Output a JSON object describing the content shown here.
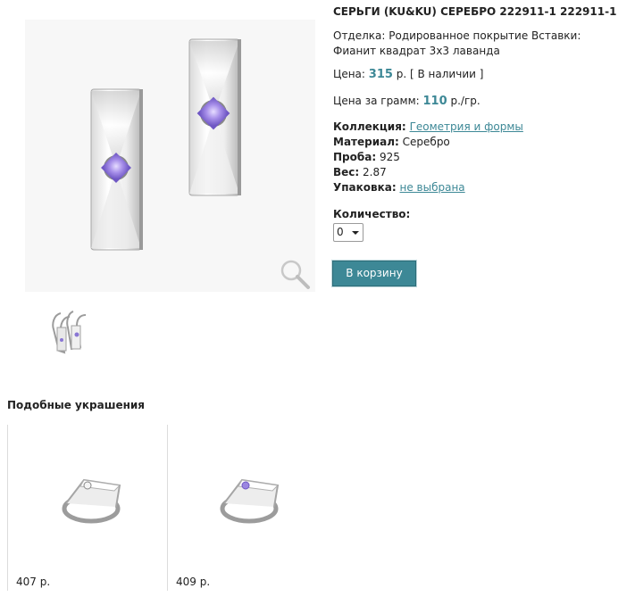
{
  "product": {
    "title": "СЕРЬГИ (KU&KU) СЕРЕБРО 222911-1 222911-1",
    "finish": "Отделка: Родированное покрытие Вставки: Фианит квадрат 3х3 лаванда",
    "price_label": "Цена:",
    "price_value": "315",
    "price_unit": "р.",
    "availability": "[ В наличии ]",
    "price_per_gram_label": "Цена за грамм:",
    "price_per_gram_value": "110",
    "price_per_gram_unit": "р./гр."
  },
  "specs": {
    "collection_label": "Коллекция:",
    "collection_value": "Геометрия и формы",
    "material_label": "Материал:",
    "material_value": "Серебро",
    "probe_label": "Проба:",
    "probe_value": "925",
    "weight_label": "Вес:",
    "weight_value": "2.87",
    "packaging_label": "Упаковка:",
    "packaging_value": "не выбрана"
  },
  "quantity": {
    "label": "Количество:",
    "value": "0"
  },
  "cart_button": "В корзину",
  "similar": {
    "heading": "Подобные украшения",
    "items": [
      {
        "price": "407 р."
      },
      {
        "price": "409 р."
      }
    ]
  },
  "colors": {
    "accent": "#3d8896",
    "stone": "#9b86e0"
  }
}
